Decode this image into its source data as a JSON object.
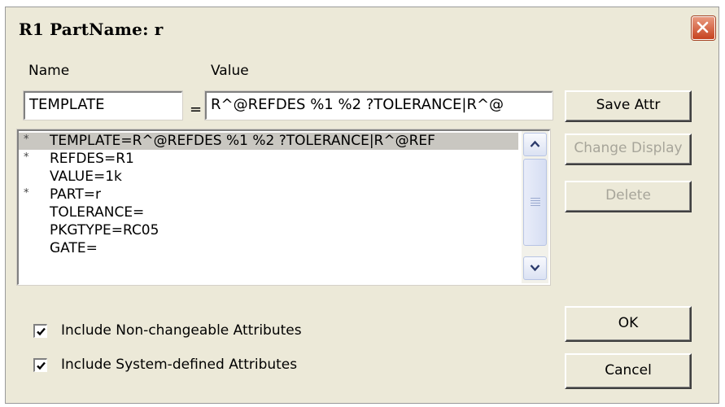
{
  "window": {
    "title": "R1   PartName: r",
    "close_icon": "close-icon"
  },
  "labels": {
    "name": "Name",
    "value": "Value",
    "equals": "="
  },
  "fields": {
    "name_value": "TEMPLATE",
    "value_value": "R^@REFDES %1 %2 ?TOLERANCE|R^@"
  },
  "attributes": [
    {
      "star": "*",
      "text": "TEMPLATE=R^@REFDES %1 %2 ?TOLERANCE|R^@REF",
      "selected": true
    },
    {
      "star": "*",
      "text": "REFDES=R1"
    },
    {
      "star": "",
      "text": "VALUE=1k"
    },
    {
      "star": "*",
      "text": "PART=r"
    },
    {
      "star": "",
      "text": "TOLERANCE="
    },
    {
      "star": "",
      "text": "PKGTYPE=RC05"
    },
    {
      "star": "",
      "text": "GATE="
    }
  ],
  "buttons": {
    "save_attr": "Save Attr",
    "change_display": "Change Display",
    "delete": "Delete",
    "ok": "OK",
    "cancel": "Cancel"
  },
  "checkboxes": {
    "non_changeable": {
      "label": "Include Non-changeable Attributes",
      "checked": true
    },
    "system_defined": {
      "label": "Include System-defined Attributes",
      "checked": true
    }
  },
  "colors": {
    "dialog_bg": "#ece9d8",
    "selected_row": "#c9c7c1",
    "close_button": "#c6421f",
    "disabled_text": "#a7a59a"
  }
}
